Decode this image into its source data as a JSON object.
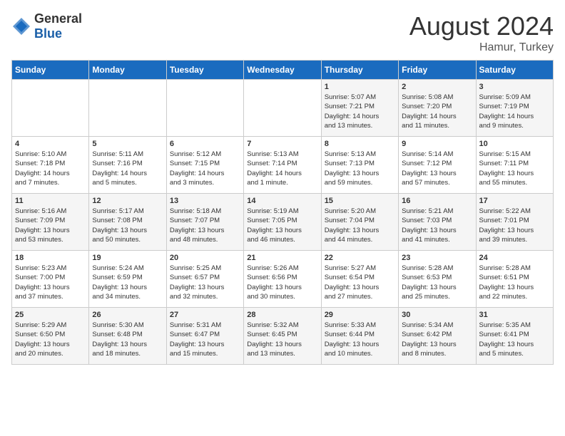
{
  "header": {
    "logo_general": "General",
    "logo_blue": "Blue",
    "month_year": "August 2024",
    "location": "Hamur, Turkey"
  },
  "days_of_week": [
    "Sunday",
    "Monday",
    "Tuesday",
    "Wednesday",
    "Thursday",
    "Friday",
    "Saturday"
  ],
  "weeks": [
    [
      {
        "day": "",
        "data": ""
      },
      {
        "day": "",
        "data": ""
      },
      {
        "day": "",
        "data": ""
      },
      {
        "day": "",
        "data": ""
      },
      {
        "day": "1",
        "data": "Sunrise: 5:07 AM\nSunset: 7:21 PM\nDaylight: 14 hours\nand 13 minutes."
      },
      {
        "day": "2",
        "data": "Sunrise: 5:08 AM\nSunset: 7:20 PM\nDaylight: 14 hours\nand 11 minutes."
      },
      {
        "day": "3",
        "data": "Sunrise: 5:09 AM\nSunset: 7:19 PM\nDaylight: 14 hours\nand 9 minutes."
      }
    ],
    [
      {
        "day": "4",
        "data": "Sunrise: 5:10 AM\nSunset: 7:18 PM\nDaylight: 14 hours\nand 7 minutes."
      },
      {
        "day": "5",
        "data": "Sunrise: 5:11 AM\nSunset: 7:16 PM\nDaylight: 14 hours\nand 5 minutes."
      },
      {
        "day": "6",
        "data": "Sunrise: 5:12 AM\nSunset: 7:15 PM\nDaylight: 14 hours\nand 3 minutes."
      },
      {
        "day": "7",
        "data": "Sunrise: 5:13 AM\nSunset: 7:14 PM\nDaylight: 14 hours\nand 1 minute."
      },
      {
        "day": "8",
        "data": "Sunrise: 5:13 AM\nSunset: 7:13 PM\nDaylight: 13 hours\nand 59 minutes."
      },
      {
        "day": "9",
        "data": "Sunrise: 5:14 AM\nSunset: 7:12 PM\nDaylight: 13 hours\nand 57 minutes."
      },
      {
        "day": "10",
        "data": "Sunrise: 5:15 AM\nSunset: 7:11 PM\nDaylight: 13 hours\nand 55 minutes."
      }
    ],
    [
      {
        "day": "11",
        "data": "Sunrise: 5:16 AM\nSunset: 7:09 PM\nDaylight: 13 hours\nand 53 minutes."
      },
      {
        "day": "12",
        "data": "Sunrise: 5:17 AM\nSunset: 7:08 PM\nDaylight: 13 hours\nand 50 minutes."
      },
      {
        "day": "13",
        "data": "Sunrise: 5:18 AM\nSunset: 7:07 PM\nDaylight: 13 hours\nand 48 minutes."
      },
      {
        "day": "14",
        "data": "Sunrise: 5:19 AM\nSunset: 7:05 PM\nDaylight: 13 hours\nand 46 minutes."
      },
      {
        "day": "15",
        "data": "Sunrise: 5:20 AM\nSunset: 7:04 PM\nDaylight: 13 hours\nand 44 minutes."
      },
      {
        "day": "16",
        "data": "Sunrise: 5:21 AM\nSunset: 7:03 PM\nDaylight: 13 hours\nand 41 minutes."
      },
      {
        "day": "17",
        "data": "Sunrise: 5:22 AM\nSunset: 7:01 PM\nDaylight: 13 hours\nand 39 minutes."
      }
    ],
    [
      {
        "day": "18",
        "data": "Sunrise: 5:23 AM\nSunset: 7:00 PM\nDaylight: 13 hours\nand 37 minutes."
      },
      {
        "day": "19",
        "data": "Sunrise: 5:24 AM\nSunset: 6:59 PM\nDaylight: 13 hours\nand 34 minutes."
      },
      {
        "day": "20",
        "data": "Sunrise: 5:25 AM\nSunset: 6:57 PM\nDaylight: 13 hours\nand 32 minutes."
      },
      {
        "day": "21",
        "data": "Sunrise: 5:26 AM\nSunset: 6:56 PM\nDaylight: 13 hours\nand 30 minutes."
      },
      {
        "day": "22",
        "data": "Sunrise: 5:27 AM\nSunset: 6:54 PM\nDaylight: 13 hours\nand 27 minutes."
      },
      {
        "day": "23",
        "data": "Sunrise: 5:28 AM\nSunset: 6:53 PM\nDaylight: 13 hours\nand 25 minutes."
      },
      {
        "day": "24",
        "data": "Sunrise: 5:28 AM\nSunset: 6:51 PM\nDaylight: 13 hours\nand 22 minutes."
      }
    ],
    [
      {
        "day": "25",
        "data": "Sunrise: 5:29 AM\nSunset: 6:50 PM\nDaylight: 13 hours\nand 20 minutes."
      },
      {
        "day": "26",
        "data": "Sunrise: 5:30 AM\nSunset: 6:48 PM\nDaylight: 13 hours\nand 18 minutes."
      },
      {
        "day": "27",
        "data": "Sunrise: 5:31 AM\nSunset: 6:47 PM\nDaylight: 13 hours\nand 15 minutes."
      },
      {
        "day": "28",
        "data": "Sunrise: 5:32 AM\nSunset: 6:45 PM\nDaylight: 13 hours\nand 13 minutes."
      },
      {
        "day": "29",
        "data": "Sunrise: 5:33 AM\nSunset: 6:44 PM\nDaylight: 13 hours\nand 10 minutes."
      },
      {
        "day": "30",
        "data": "Sunrise: 5:34 AM\nSunset: 6:42 PM\nDaylight: 13 hours\nand 8 minutes."
      },
      {
        "day": "31",
        "data": "Sunrise: 5:35 AM\nSunset: 6:41 PM\nDaylight: 13 hours\nand 5 minutes."
      }
    ]
  ]
}
